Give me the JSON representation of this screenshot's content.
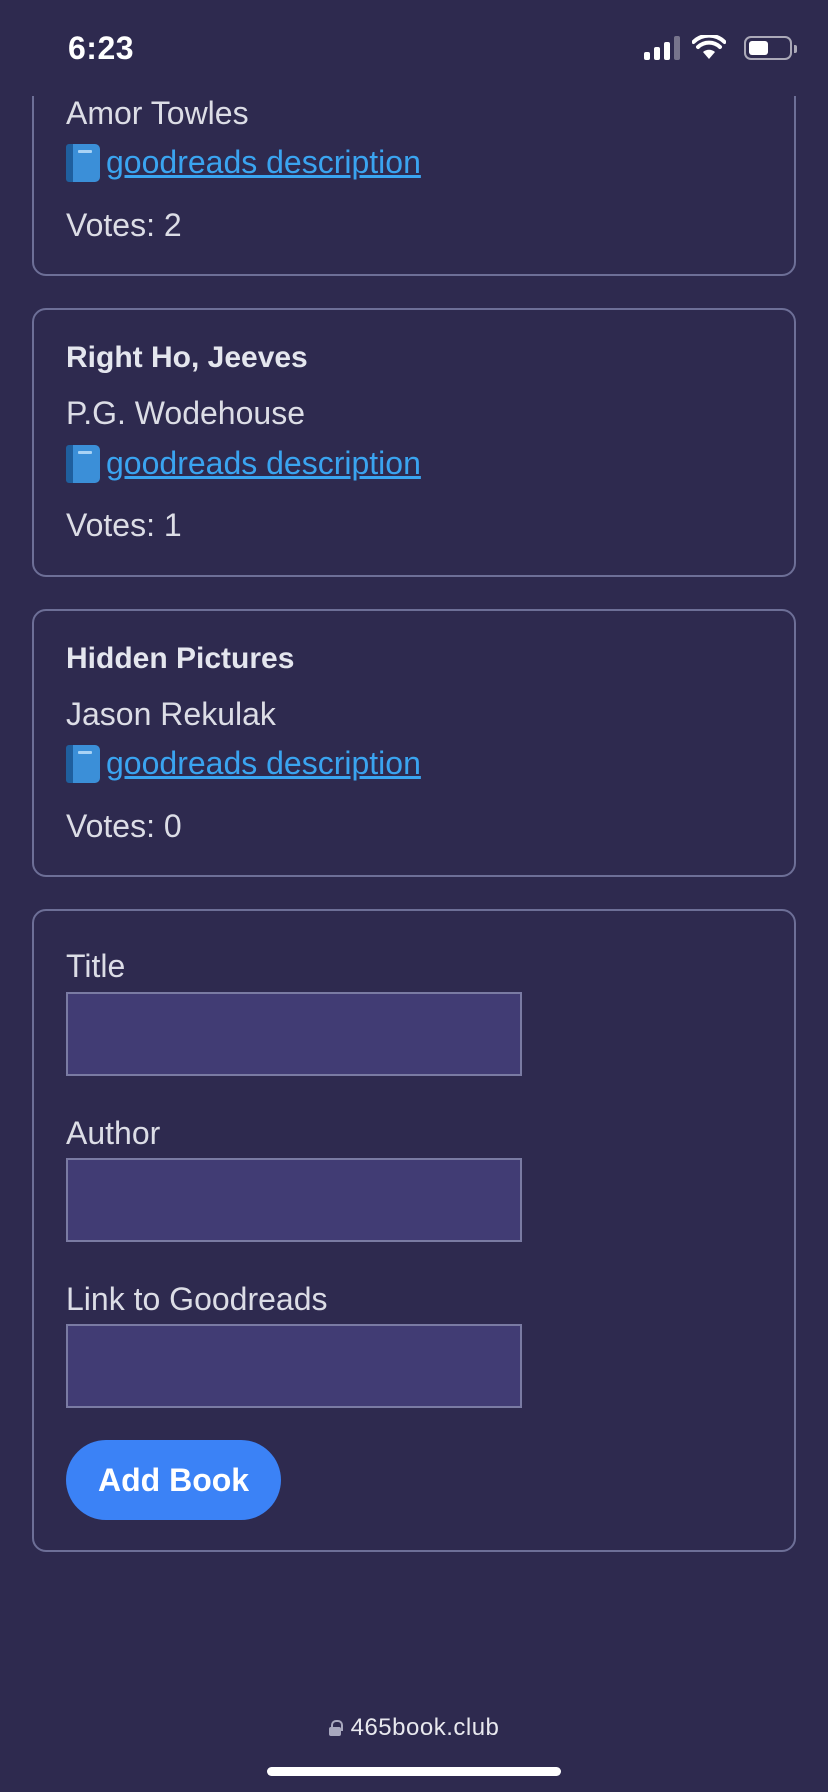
{
  "status_bar": {
    "time": "6:23",
    "battery_level": 0.5
  },
  "books": [
    {
      "title": "",
      "author": "Amor Towles",
      "link_label": "goodreads description",
      "link_icon": "blue-book-icon",
      "votes": "Votes: 2"
    },
    {
      "title": "Right Ho, Jeeves",
      "author": "P.G. Wodehouse",
      "link_label": "goodreads description",
      "link_icon": "blue-book-icon",
      "votes": "Votes: 1"
    },
    {
      "title": "Hidden Pictures",
      "author": "Jason Rekulak",
      "link_label": "goodreads description",
      "link_icon": "blue-book-icon",
      "votes": "Votes: 0"
    }
  ],
  "form": {
    "title_label": "Title",
    "title_value": "",
    "author_label": "Author",
    "author_value": "",
    "link_label": "Link to Goodreads",
    "link_value": "",
    "submit_label": "Add Book"
  },
  "browser": {
    "url": "465book.club"
  },
  "colors": {
    "background": "#2e2a4f",
    "card_border": "#6d6f97",
    "input_background": "#413c74",
    "link": "#3aa4f0",
    "button": "#3b82f6"
  }
}
